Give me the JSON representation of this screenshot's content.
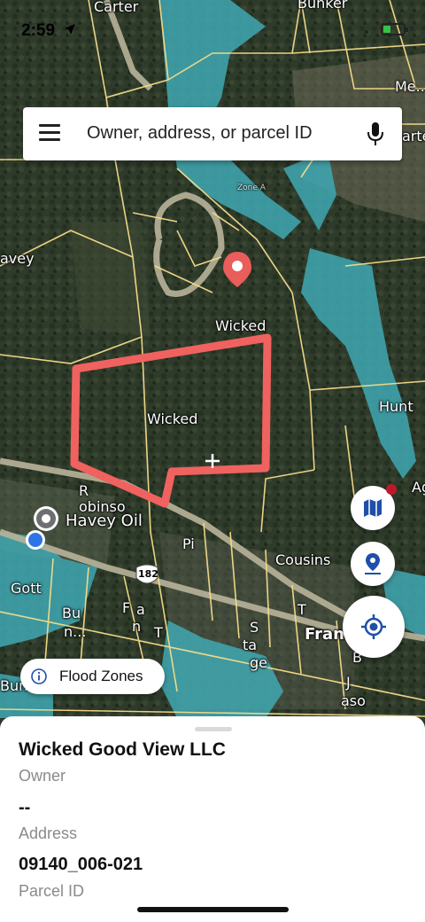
{
  "status_bar": {
    "time": "2:59"
  },
  "search": {
    "placeholder": "Owner, address, or parcel ID"
  },
  "map": {
    "labels": {
      "carter": "Carter",
      "bunker": "Bunker",
      "me": "Me..",
      "carter_right": "arter",
      "avey": "avey",
      "zone_a": "Zone A",
      "wicked_top": "Wicked",
      "wicked_center": "Wicked",
      "hunt": "Hunt",
      "ag": "Ag",
      "robinson_r": "R",
      "robinson_rest": "obinso",
      "havey_oil": "Havey Oil",
      "pi": "Pi",
      "route_182": "182",
      "cousins": "Cousins",
      "gott": "Gott",
      "bu": "Bu",
      "n_dots": "n...",
      "f": "F",
      "a": "a",
      "n": "n",
      "t1": "T",
      "s": "S",
      "ta": "ta",
      "ge": "ge",
      "t2": "T",
      "frank": "Frank",
      "b": "B",
      "j": "J",
      "aso": "aso",
      "bun": "Bun"
    }
  },
  "flood_zones": {
    "label": "Flood Zones"
  },
  "parcel": {
    "owner": "Wicked Good View LLC",
    "owner_label": "Owner",
    "address": "--",
    "address_label": "Address",
    "parcel_id": "09140_006-021",
    "parcel_id_label": "Parcel ID"
  },
  "colors": {
    "water": "#3fa8b3",
    "parcel_line": "#f6dc8a",
    "selected_parcel": "#f0625f",
    "pin": "#e95d5b",
    "accent": "#1f4fa8"
  }
}
